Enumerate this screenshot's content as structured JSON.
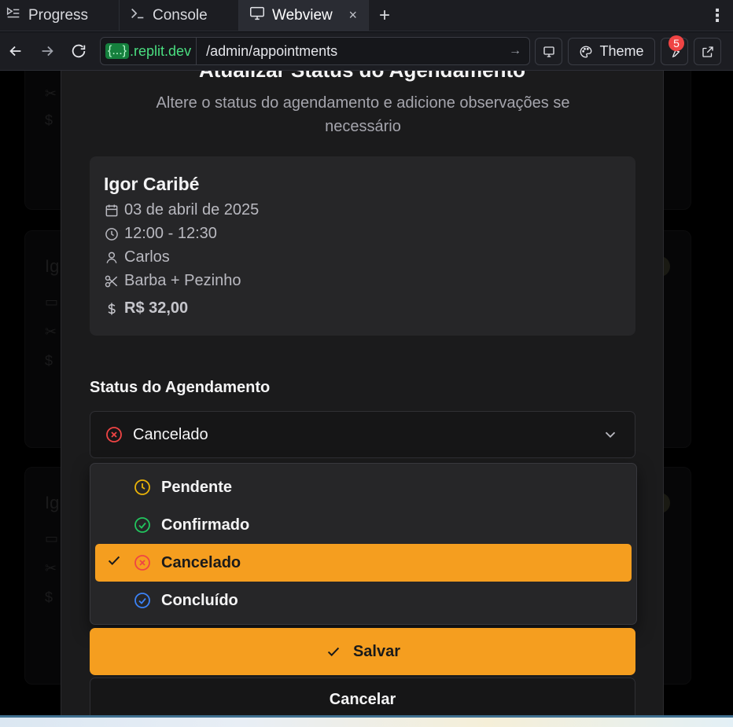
{
  "tabs": {
    "progress": "Progress",
    "console": "Console",
    "webview": "Webview",
    "close": "×",
    "add": "+"
  },
  "address": {
    "domain_brace": "{...}",
    "domain": ".replit.dev",
    "path": "/admin/appointments",
    "theme_label": "Theme",
    "notifications_count": "5"
  },
  "dialog": {
    "title": "Atualizar Status do Agendamento",
    "subtitle": "Altere o status do agendamento e adicione observações se necessário"
  },
  "appointment": {
    "client": "Igor Caribé",
    "date": "03 de abril de 2025",
    "time": "12:00 - 12:30",
    "barber": "Carlos",
    "service": "Barba + Pezinho",
    "price": "R$ 32,00"
  },
  "status": {
    "label": "Status do Agendamento",
    "selected": "Cancelado",
    "options": [
      {
        "label": "Pendente",
        "icon": "clock-icon",
        "color": "#eab308"
      },
      {
        "label": "Confirmado",
        "icon": "check-circle-icon",
        "color": "#22c55e"
      },
      {
        "label": "Cancelado",
        "icon": "x-circle-icon",
        "color": "#ef4444"
      },
      {
        "label": "Concluído",
        "icon": "check-circle-icon",
        "color": "#3b82f6"
      }
    ]
  },
  "actions": {
    "save": "Salvar",
    "cancel": "Cancelar"
  },
  "background": {
    "card_initial": "Ig"
  },
  "colors": {
    "accent": "#f59e1f",
    "dialog_bg": "#1b1b1c"
  }
}
